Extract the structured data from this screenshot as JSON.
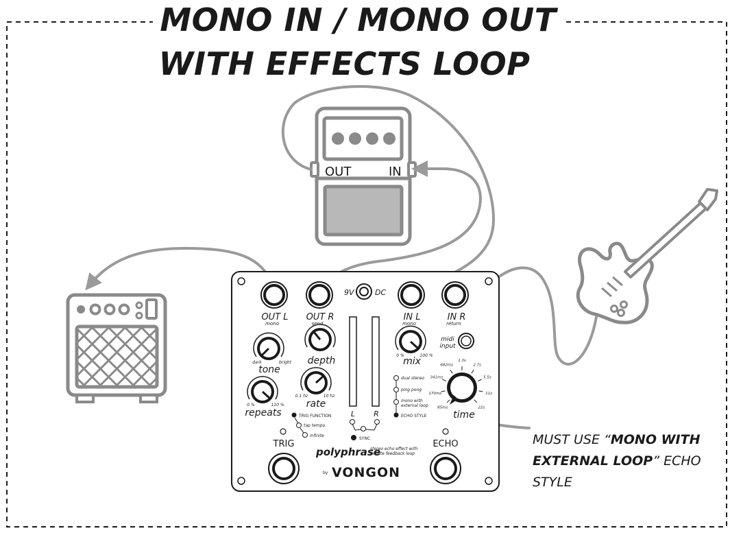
{
  "title": {
    "line1": "MONO IN / MONO OUT",
    "line2": "WITH EFFECTS LOOP"
  },
  "effects_pedal": {
    "out_label": "OUT",
    "in_label": "IN"
  },
  "device": {
    "name": "polyphrase",
    "tagline_1": "stereo echo effect with",
    "tagline_2": "infinite feedback loop",
    "by": "by",
    "brand": "VONGON",
    "jacks": {
      "out_l": "OUT  L",
      "out_l_sub": "mono",
      "out_r": "OUT  R",
      "out_r_sub": "send",
      "power_9v": "9V",
      "power_dc": "DC",
      "in_l": "IN  L",
      "in_l_sub": "mono",
      "in_r": "IN  R",
      "in_r_sub": "return",
      "midi_1": "midi",
      "midi_2": "input"
    },
    "knobs": {
      "tone": "tone",
      "tone_min": "dark",
      "tone_max": "bright",
      "depth": "depth",
      "repeats": "repeats",
      "repeats_min": "0 %",
      "repeats_max": "110 %",
      "rate": "rate",
      "rate_min": "0.1 hz",
      "rate_max": "10 hz",
      "mix": "mix",
      "mix_min": "0 %",
      "mix_max": "100 %",
      "time": "time",
      "time_marks": [
        "85ms",
        "170ms",
        "341ms",
        "682ms",
        "1.3s",
        "2.7s",
        "5.5s",
        "11s",
        "22s"
      ]
    },
    "meters": {
      "left": "L",
      "right": "R",
      "sync": "SYNC"
    },
    "trig_function": {
      "title": "TRIG FUNCTION",
      "options": [
        "tap tempo",
        "infinite"
      ]
    },
    "echo_style": {
      "title": "ECHO STYLE",
      "options": [
        "dual stereo",
        "ping pong",
        "mono with",
        "external loop"
      ]
    },
    "footswitches": {
      "trig": "TRIG",
      "echo": "ECHO"
    }
  },
  "note": {
    "line1_pre": "MUST USE “",
    "line1_bold": "MONO WITH",
    "line2_bold": "EXTERNAL LOOP",
    "line2_post": "” ECHO",
    "line3": "STYLE"
  },
  "colors": {
    "cable": "#9a9a9a",
    "outline": "#7a7a7a",
    "ink": "#1a1a1a"
  }
}
